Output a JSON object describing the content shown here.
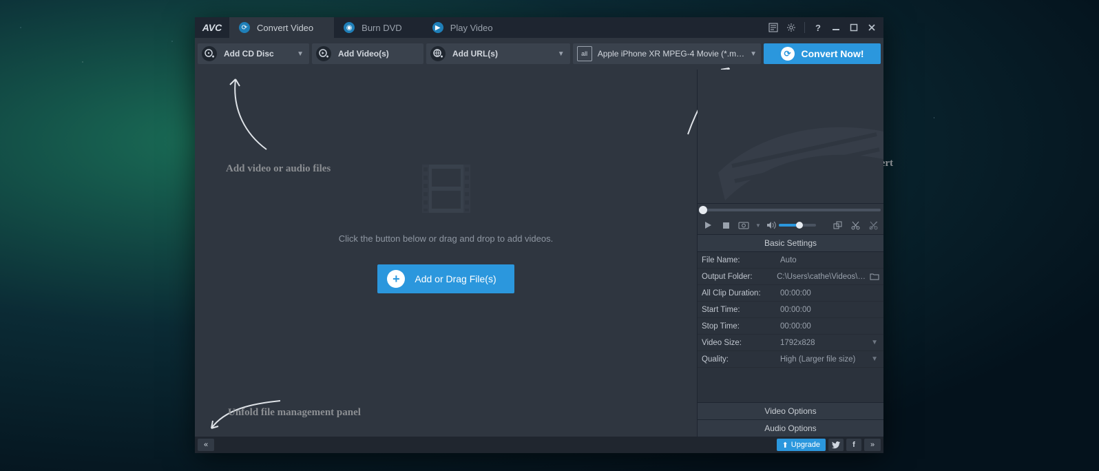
{
  "app": {
    "logo": "AVC"
  },
  "tabs": {
    "convert": "Convert Video",
    "burn": "Burn DVD",
    "play": "Play Video"
  },
  "toolbar": {
    "add_cd": "Add CD Disc",
    "add_videos": "Add Video(s)",
    "add_urls": "Add URL(s)",
    "profile_prefix": "all",
    "profile_text": "Apple iPhone XR MPEG-4 Movie (*.m…",
    "convert": "Convert Now!"
  },
  "drop": {
    "hint": "Click the button below or drag and drop to add videos.",
    "add_button": "Add or Drag File(s)"
  },
  "annotations": {
    "a1": "Add video or audio files",
    "a2": "Choose output profile and convert",
    "a3": "Unfold file management panel"
  },
  "settings": {
    "title": "Basic Settings",
    "rows": {
      "file_name": {
        "label": "File Name:",
        "value": "Auto"
      },
      "output_folder": {
        "label": "Output Folder:",
        "value": "C:\\Users\\cathe\\Videos\\…"
      },
      "all_clip": {
        "label": "All Clip Duration:",
        "value": "00:00:00"
      },
      "start_time": {
        "label": "Start Time:",
        "value": "00:00:00"
      },
      "stop_time": {
        "label": "Stop Time:",
        "value": "00:00:00"
      },
      "video_size": {
        "label": "Video Size:",
        "value": "1792x828"
      },
      "quality": {
        "label": "Quality:",
        "value": "High (Larger file size)"
      }
    },
    "video_options": "Video Options",
    "audio_options": "Audio Options"
  },
  "statusbar": {
    "upgrade": "Upgrade"
  }
}
